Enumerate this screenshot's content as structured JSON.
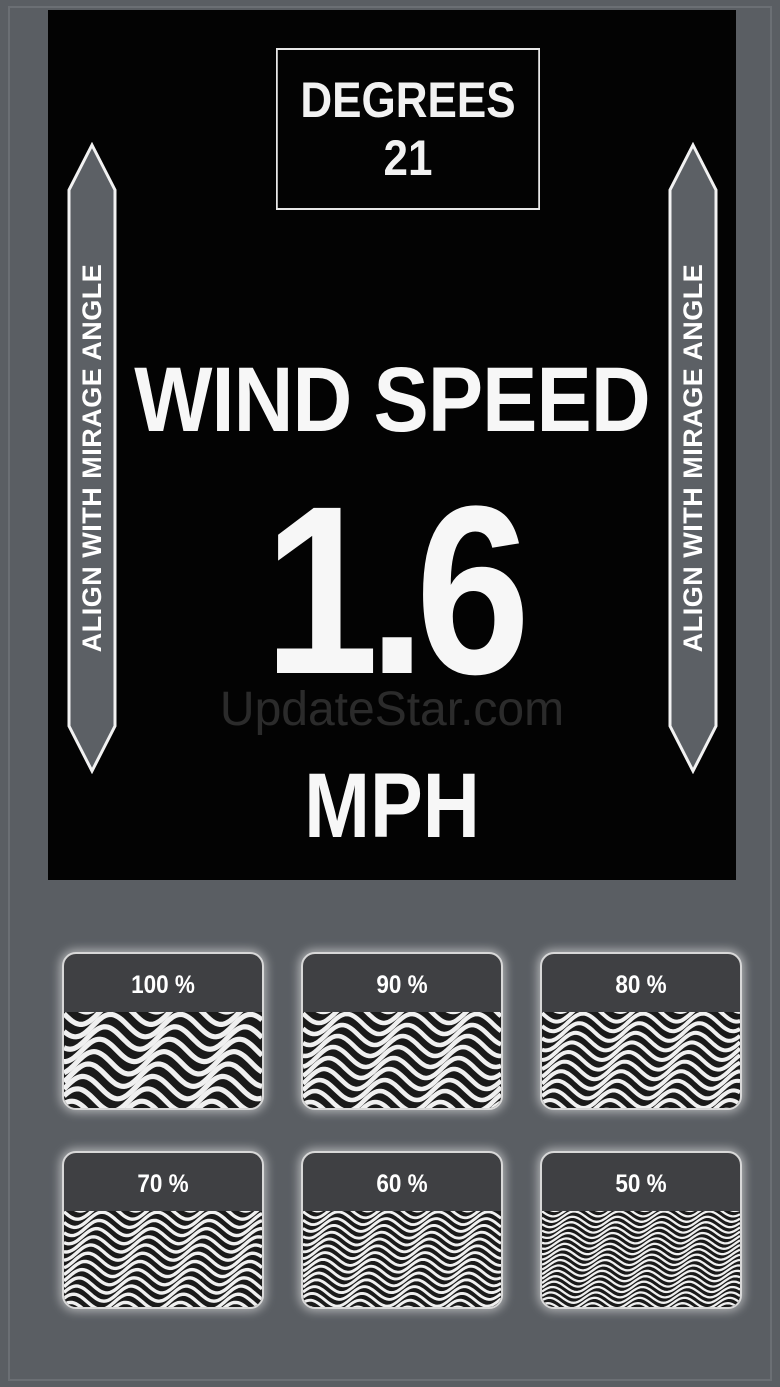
{
  "display": {
    "degrees_label": "DEGREES",
    "degrees_value": "21",
    "side_label_left": "ALIGN WITH MIRAGE ANGLE",
    "side_label_right": "ALIGN WITH MIRAGE ANGLE",
    "title": "WIND SPEED",
    "value": "1.6",
    "unit": "MPH",
    "watermark": "UpdateStar.com"
  },
  "intensity_tiles": [
    {
      "label": "100 %",
      "level": 1.0
    },
    {
      "label": "90 %",
      "level": 0.9
    },
    {
      "label": "80 %",
      "level": 0.8
    },
    {
      "label": "70 %",
      "level": 0.7
    },
    {
      "label": "60 %",
      "level": 0.6
    },
    {
      "label": "50 %",
      "level": 0.5
    }
  ],
  "colors": {
    "background": "#5a5e63",
    "display_bg": "#030303",
    "arrow_fill": "#5c6065",
    "text": "#f7f7f7"
  }
}
